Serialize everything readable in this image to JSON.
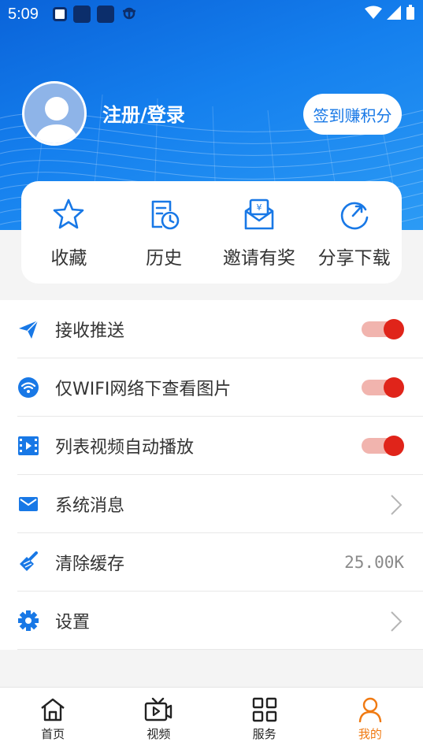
{
  "status_bar": {
    "time": "5:09",
    "icons": [
      "a-icon",
      "square-icon",
      "square-icon",
      "bug-icon"
    ],
    "right_icons": [
      "wifi-icon",
      "signal-icon",
      "battery-icon"
    ]
  },
  "colors": {
    "brand_blue": "#1878e6",
    "toggle_on": "#e0241a",
    "active_tab": "#f07a12"
  },
  "profile": {
    "login_label": "注册/登录",
    "signin_button": "签到赚积分"
  },
  "quick_actions": [
    {
      "label": "收藏",
      "icon": "star-icon"
    },
    {
      "label": "历史",
      "icon": "history-icon"
    },
    {
      "label": "邀请有奖",
      "icon": "invite-envelope-icon"
    },
    {
      "label": "分享下载",
      "icon": "share-refresh-icon"
    }
  ],
  "settings": [
    {
      "label": "接收推送",
      "icon": "paper-plane-icon",
      "control": "toggle",
      "on": true
    },
    {
      "label": "仅WIFI网络下查看图片",
      "icon": "wifi-icon",
      "control": "toggle",
      "on": true
    },
    {
      "label": "列表视频自动播放",
      "icon": "video-film-icon",
      "control": "toggle",
      "on": true
    },
    {
      "label": "系统消息",
      "icon": "mail-icon",
      "control": "chevron"
    },
    {
      "label": "清除缓存",
      "icon": "broom-icon",
      "control": "value",
      "value": "25.00K"
    },
    {
      "label": "设置",
      "icon": "gear-icon",
      "control": "chevron"
    }
  ],
  "nav": [
    {
      "label": "首页",
      "icon": "home-icon",
      "active": false
    },
    {
      "label": "视频",
      "icon": "tv-icon",
      "active": false
    },
    {
      "label": "服务",
      "icon": "grid-icon",
      "active": false
    },
    {
      "label": "我的",
      "icon": "user-icon",
      "active": true
    }
  ]
}
